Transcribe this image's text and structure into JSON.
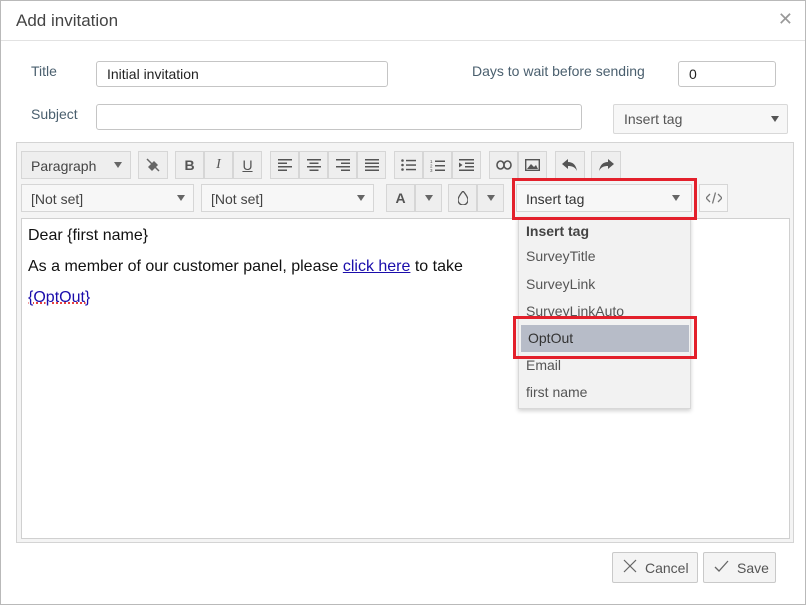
{
  "dialog": {
    "title": "Add invitation",
    "close_icon": "close-icon"
  },
  "form": {
    "title_label": "Title",
    "title_value": "Initial invitation",
    "days_label": "Days to wait before sending",
    "days_value": "0",
    "subject_label": "Subject",
    "subject_value": "",
    "insert_tag_label": "Insert tag"
  },
  "toolbar": {
    "paragraph": "Paragraph",
    "font_family": "[Not set]",
    "font_size": "[Not set]",
    "font_color_glyph": "A",
    "insert_tag": "Insert tag",
    "icons": [
      "eraser-icon",
      "bold-icon",
      "italic-icon",
      "underline-icon",
      "align-left-icon",
      "align-center-icon",
      "align-right-icon",
      "align-justify-icon",
      "bullet-list-icon",
      "numbered-list-icon",
      "indent-icon",
      "link-icon",
      "image-icon",
      "undo-icon",
      "redo-icon",
      "background-color-icon",
      "source-code-icon"
    ]
  },
  "content": {
    "line1": "Dear {first name}",
    "line2_prefix": "As a member of our customer panel, please ",
    "line2_link": "click here",
    "line2_suffix": " to take",
    "line3_link": "{OptOut}"
  },
  "dropdown": {
    "header": "Insert tag",
    "items": [
      "SurveyTitle",
      "SurveyLink",
      "SurveyLinkAuto",
      "OptOut",
      "Email",
      "first name"
    ],
    "selected": "OptOut"
  },
  "footer": {
    "cancel": "Cancel",
    "save": "Save"
  },
  "colors": {
    "highlight": "#e3202b",
    "link": "#1a0dab",
    "selected_item_bg": "#b7bcc8"
  }
}
